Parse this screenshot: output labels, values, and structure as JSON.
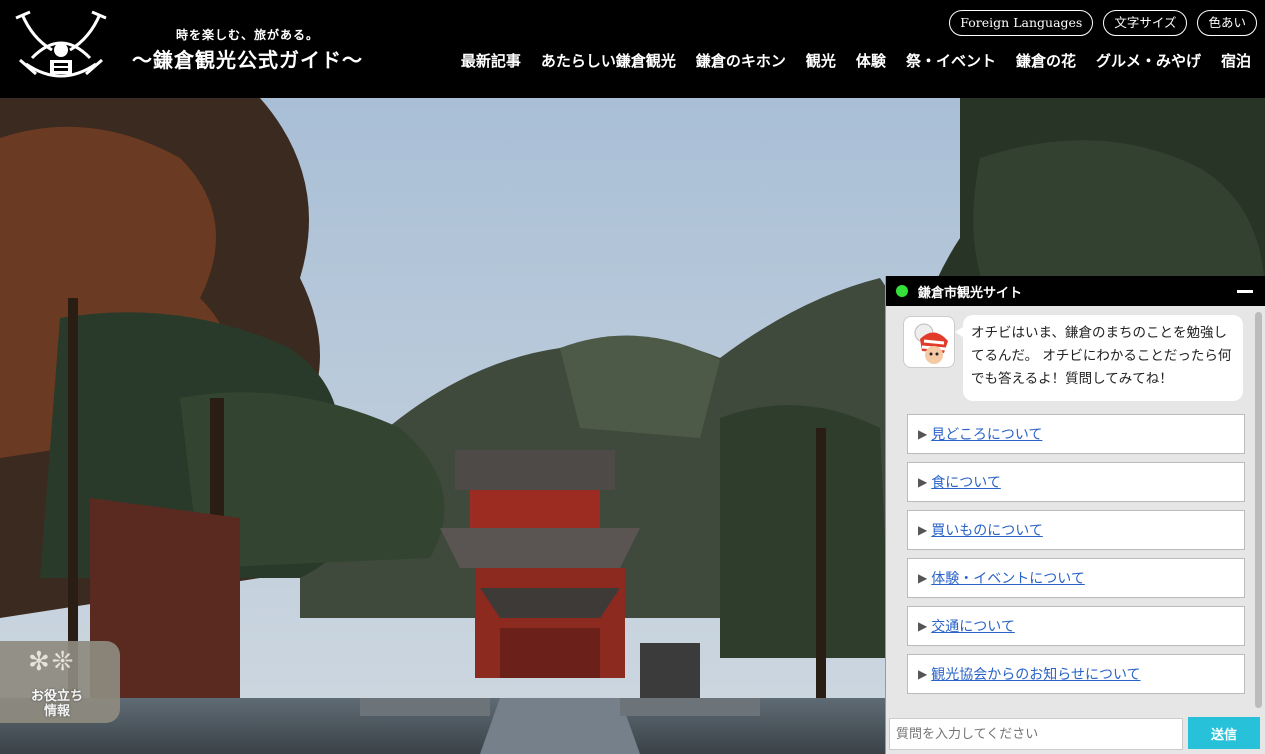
{
  "header": {
    "tagline": "時を楽しむ、旅がある。",
    "title": "〜鎌倉観光公式ガイド〜",
    "util_buttons": [
      "Foreign Languages",
      "文字サイズ",
      "色あい"
    ],
    "nav": [
      "最新記事",
      "あたらしい鎌倉観光",
      "鎌倉のキホン",
      "観光",
      "体験",
      "祭・イベント",
      "鎌倉の花",
      "グルメ・みやげ",
      "宿泊"
    ]
  },
  "useful_info": {
    "label_line1": "お役立ち",
    "label_line2": "情報",
    "icon": "snowflake-icon"
  },
  "chat": {
    "title": "鎌倉市観光サイト",
    "status_color": "#35e03a",
    "message": "オチビはいま、鎌倉のまちのことを勉強してるんだ。 オチビにわかることだったら何でも答えるよ！質問してみてね！",
    "options": [
      "見どころについて",
      "食について",
      "買いものについて",
      "体験・イベントについて",
      "交通について",
      "観光協会からのお知らせについて"
    ],
    "input_placeholder": "質問を入力してください",
    "send_label": "送信"
  },
  "colors": {
    "accent": "#27c2da",
    "link": "#2a63c8"
  }
}
